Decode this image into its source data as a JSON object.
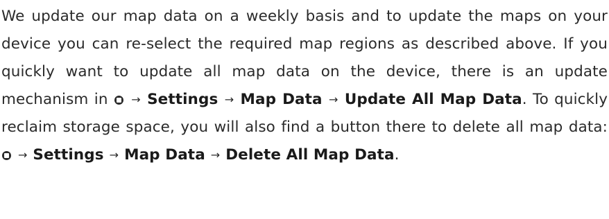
{
  "paragraph": {
    "intro": "We update our map data on a weekly basis and to update the maps on your device you can re-select the required map regions as described above. If you quickly want to update all map data on the device, there is an update mechanism in",
    "path_update": {
      "step1": "Settings",
      "step2": "Map Data",
      "step3": "Update All Map Data"
    },
    "middle": ". To quickly reclaim storage space, you will also find a button there to delete all map data:",
    "path_delete": {
      "step1": "Settings",
      "step2": "Map Data",
      "step3": "Delete All Map Data"
    },
    "end": "."
  },
  "icons": {
    "menu": "menu-icon",
    "arrow": "→"
  }
}
